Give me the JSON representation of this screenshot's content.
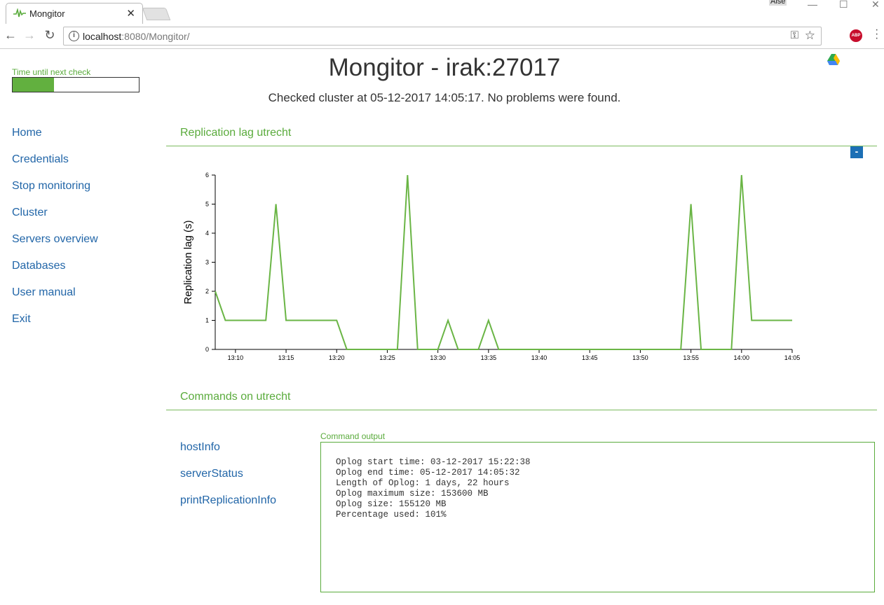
{
  "browser": {
    "tab_title": "Mongitor",
    "profile_name": "Alse",
    "url_host": "localhost",
    "url_path": ":8080/Mongitor/"
  },
  "timer": {
    "label": "Time until next check",
    "progress": 0.33
  },
  "header": {
    "title": "Mongitor - irak:27017",
    "subtitle": "Checked cluster at 05-12-2017 14:05:17. No problems were found."
  },
  "nav": {
    "items": [
      {
        "label": "Home"
      },
      {
        "label": "Credentials"
      },
      {
        "label": "Stop monitoring"
      },
      {
        "label": "Cluster"
      },
      {
        "label": "Servers overview"
      },
      {
        "label": "Databases"
      },
      {
        "label": "User manual"
      },
      {
        "label": "Exit"
      }
    ]
  },
  "lag_section": {
    "title": "Replication lag utrecht",
    "collapse_label": "-"
  },
  "chart_data": {
    "type": "line",
    "ylabel": "Replication lag (s)",
    "xlabel": "",
    "ylim": [
      0,
      6
    ],
    "yticks": [
      0,
      1,
      2,
      3,
      4,
      5,
      6
    ],
    "xlim": [
      "13:08",
      "14:05"
    ],
    "xticks": [
      "13:10",
      "13:15",
      "13:20",
      "13:25",
      "13:30",
      "13:35",
      "13:40",
      "13:45",
      "13:50",
      "13:55",
      "14:00",
      "14:05"
    ],
    "color": "#6ab545",
    "series": [
      {
        "x": [
          "13:08",
          "13:09",
          "13:13",
          "13:14",
          "13:15",
          "13:20",
          "13:21",
          "13:26",
          "13:27",
          "13:28",
          "13:30",
          "13:31",
          "13:32",
          "13:34",
          "13:35",
          "13:36",
          "13:54",
          "13:55",
          "13:56",
          "13:59",
          "14:00",
          "14:01",
          "14:05"
        ],
        "values": [
          2,
          1,
          1,
          5,
          1,
          1,
          0,
          0,
          6,
          0,
          0,
          1,
          0,
          0,
          1,
          0,
          0,
          5,
          0,
          0,
          6,
          1,
          1
        ]
      }
    ]
  },
  "commands_section": {
    "title": "Commands on utrecht",
    "commands": [
      {
        "label": "hostInfo"
      },
      {
        "label": "serverStatus"
      },
      {
        "label": "printReplicationInfo"
      }
    ],
    "output_label": "Command output",
    "output_text": "Oplog start time: 03-12-2017 15:22:38\nOplog end time: 05-12-2017 14:05:32\nLength of Oplog: 1 days, 22 hours\nOplog maximum size: 153600 MB\nOplog size: 155120 MB\nPercentage used: 101%"
  }
}
